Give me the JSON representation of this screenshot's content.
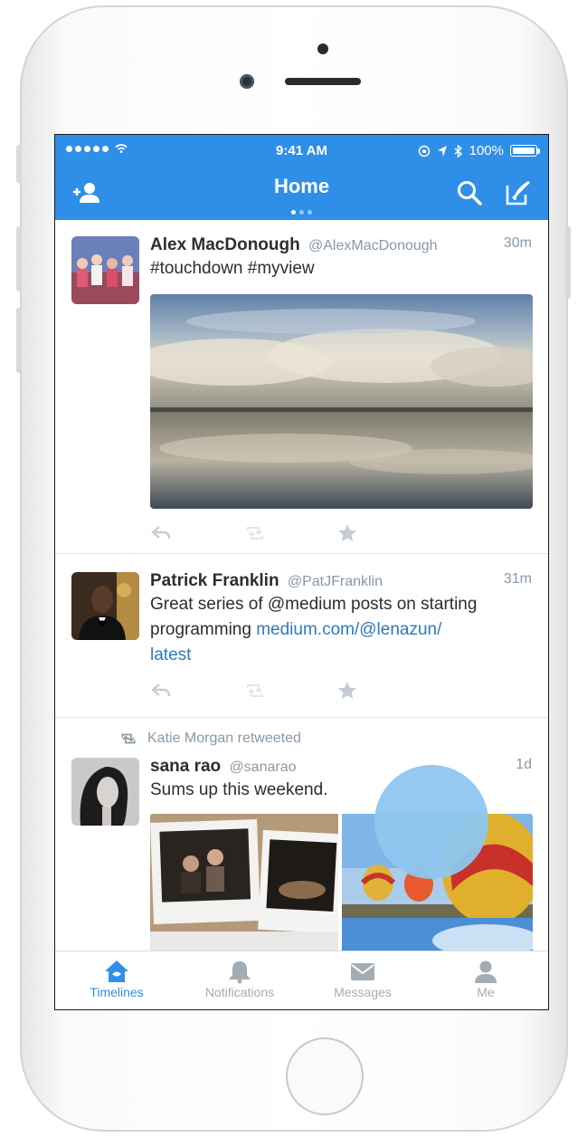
{
  "status_bar": {
    "time": "9:41 AM",
    "battery": "100%"
  },
  "nav": {
    "title": "Home"
  },
  "tweets": [
    {
      "name": "Alex MacDonough",
      "handle": "@AlexMacDonough",
      "time": "30m",
      "text": "#touchdown #myview"
    },
    {
      "name": "Patrick Franklin",
      "handle": "@PatJFranklin",
      "time": "31m",
      "text_line1": "Great series of @medium posts on starting",
      "text_line2": "programming",
      "link_part1": "medium.com/@lenazun/",
      "link_part2": "latest"
    },
    {
      "retweet_context": "Katie Morgan retweeted",
      "name": "sana rao",
      "handle": "@sanarao",
      "time": "1d",
      "text": "Sums up this weekend."
    }
  ],
  "tabs": [
    {
      "label": "Timelines",
      "icon": "home-icon"
    },
    {
      "label": "Notifications",
      "icon": "bell-icon"
    },
    {
      "label": "Messages",
      "icon": "envelope-icon"
    },
    {
      "label": "Me",
      "icon": "person-icon"
    }
  ],
  "colors": {
    "accent": "#2f8fe8",
    "link": "#2b7bb9",
    "muted": "#8899a6"
  }
}
